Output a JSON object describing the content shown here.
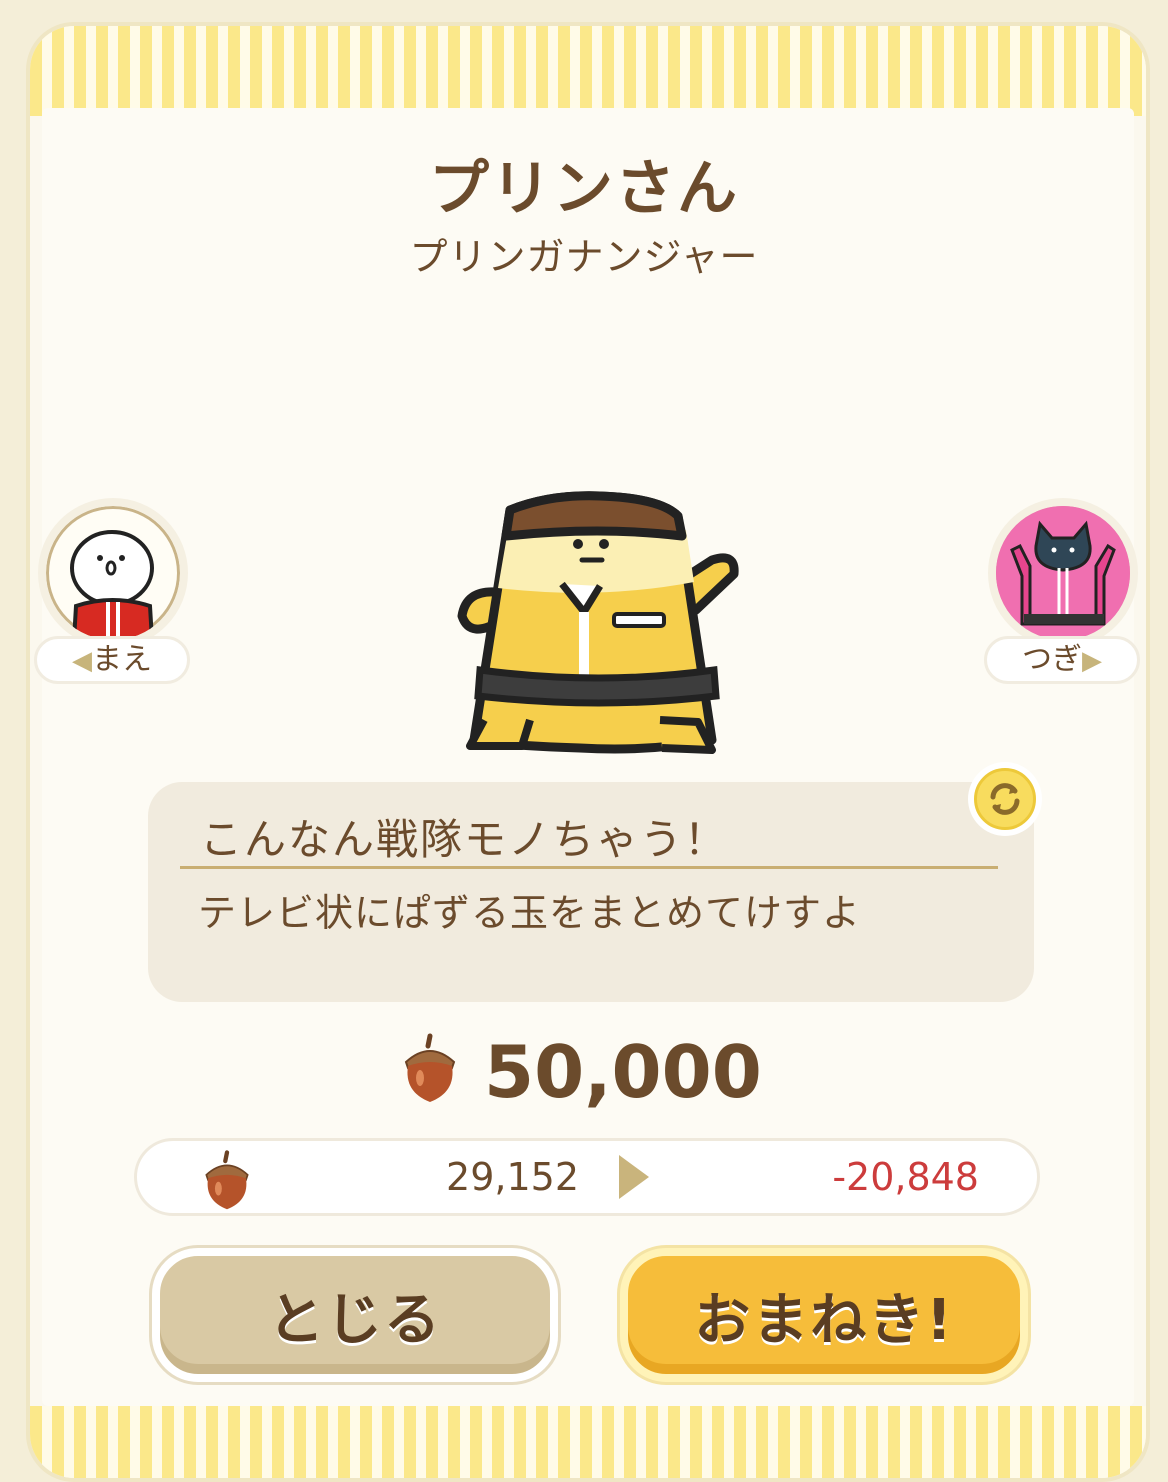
{
  "header": {
    "title": "プリンさん",
    "subtitle": "プリンガナンジャー"
  },
  "navigation": {
    "prev_label": "まえ",
    "next_label": "つぎ"
  },
  "speech": {
    "line1": "こんなん戦隊モノちゃう！",
    "line2": "テレビ状にぱずる玉をまとめてけすよ"
  },
  "cost": {
    "price": "50,000",
    "current_balance": "29,152",
    "balance_after": "-20,848"
  },
  "buttons": {
    "close_label": "とじる",
    "invite_label": "おまねき!"
  },
  "colors": {
    "text_brown": "#6b4b2c",
    "negative_red": "#cc3c3c",
    "invite_button": "#f6bd3a",
    "close_button": "#d9c9a4",
    "stripe_yellow": "#fbe88a"
  },
  "icons": [
    "acorn-icon",
    "refresh-icon",
    "triangle-left-icon",
    "triangle-right-icon"
  ]
}
